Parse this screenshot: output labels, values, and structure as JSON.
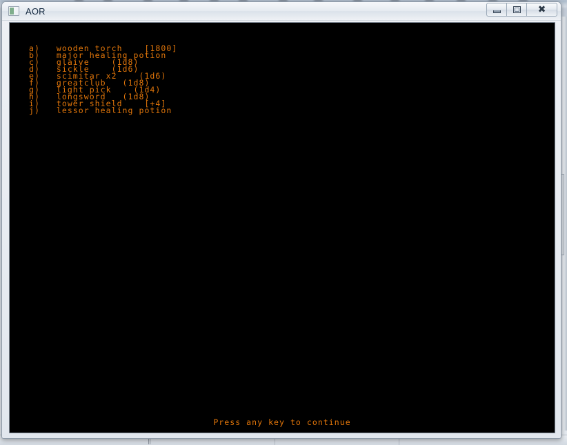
{
  "window": {
    "title": "AOR",
    "icon": "console-app-icon",
    "controls": [
      {
        "name": "minimize",
        "label": "–",
        "glyph": "minimize-icon"
      },
      {
        "name": "maximize",
        "label": "❐",
        "glyph": "maximize-icon"
      },
      {
        "name": "close",
        "label": "✕",
        "glyph": "close-icon"
      }
    ]
  },
  "console": {
    "background_color": "#000000",
    "text_color": "#e2760a",
    "items": [
      {
        "key": "a)",
        "text": "wooden torch    [1800]"
      },
      {
        "key": "b)",
        "text": "major healing potion"
      },
      {
        "key": "c)",
        "text": "glaive    (1d8)"
      },
      {
        "key": "d)",
        "text": "sickle    (1d6)"
      },
      {
        "key": "e)",
        "text": "scimitar x2    (1d6)"
      },
      {
        "key": "f)",
        "text": "greatclub   (1d8)"
      },
      {
        "key": "g)",
        "text": "light pick    (1d4)"
      },
      {
        "key": "h)",
        "text": "longsword   (1d8)"
      },
      {
        "key": "i)",
        "text": "tower shield    [+4]"
      },
      {
        "key": "j)",
        "text": "lessor healing potion"
      }
    ],
    "lines": [
      "a)   wooden torch    [1800]",
      "b)   major healing potion",
      "c)   glaive    (1d8)",
      "d)   sickle    (1d6)",
      "e)   scimitar x2    (1d6)",
      "f)   greatclub   (1d8)",
      "g)   light pick    (1d4)",
      "h)   longsword   (1d8)",
      "i)   tower shield    [+4]",
      "j)   lessor healing potion"
    ],
    "prompt": "Press any key to continue"
  },
  "desktop": {
    "taskbar_mark": "‖"
  }
}
